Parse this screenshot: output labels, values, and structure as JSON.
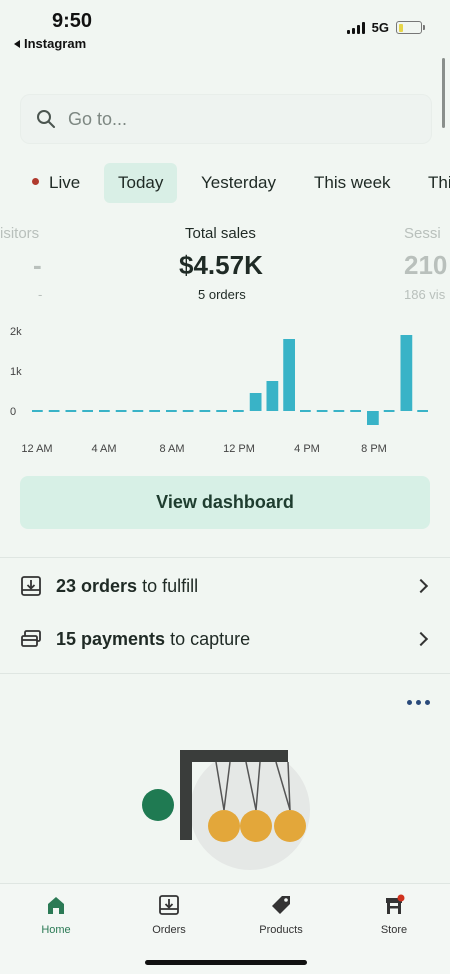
{
  "status_bar": {
    "time": "9:50",
    "back_app": "Instagram",
    "network": "5G"
  },
  "search": {
    "placeholder": "Go to..."
  },
  "periods": [
    {
      "label": "Live",
      "live": true
    },
    {
      "label": "Today",
      "active": true
    },
    {
      "label": "Yesterday"
    },
    {
      "label": "This week"
    },
    {
      "label": "Thi"
    }
  ],
  "metrics": {
    "visitors": {
      "label": "isitors",
      "value": "-",
      "sub": "-"
    },
    "total_sales": {
      "label": "Total sales",
      "value": "$4.57K",
      "sub": "5 orders"
    },
    "sessions": {
      "label": "Sessi",
      "value": "210",
      "sub": "186 vis"
    }
  },
  "chart_data": {
    "type": "bar",
    "title": "",
    "xlabel": "",
    "ylabel": "",
    "ylim": [
      -500,
      2000
    ],
    "y_ticks": [
      "2k",
      "1k",
      "0"
    ],
    "x_ticks": [
      "12 AM",
      "4 AM",
      "8 AM",
      "12 PM",
      "4 PM",
      "8 PM"
    ],
    "categories": [
      "0",
      "1",
      "2",
      "3",
      "4",
      "5",
      "6",
      "7",
      "8",
      "9",
      "10",
      "11",
      "12",
      "13",
      "14",
      "15",
      "16",
      "17",
      "18",
      "19",
      "20",
      "21",
      "22",
      "23"
    ],
    "values": [
      0,
      0,
      0,
      0,
      0,
      0,
      0,
      0,
      0,
      0,
      0,
      0,
      0,
      450,
      750,
      1800,
      0,
      0,
      0,
      0,
      -350,
      0,
      1900,
      0
    ],
    "color": "#39b3c7"
  },
  "dashboard_button": {
    "label": "View dashboard"
  },
  "tasks": [
    {
      "count": "23 orders",
      "suffix": "to fulfill",
      "icon": "fulfill-icon"
    },
    {
      "count": "15 payments",
      "suffix": "to capture",
      "icon": "payment-icon"
    }
  ],
  "nav": [
    {
      "label": "Home",
      "icon": "home-icon",
      "active": true
    },
    {
      "label": "Orders",
      "icon": "orders-icon"
    },
    {
      "label": "Products",
      "icon": "tag-icon"
    },
    {
      "label": "Store",
      "icon": "store-icon"
    }
  ],
  "colors": {
    "accent": "#2b7a55",
    "bar": "#39b3c7",
    "live_dot": "#b03a2e",
    "dashboard_bg": "#d7f0e6"
  }
}
